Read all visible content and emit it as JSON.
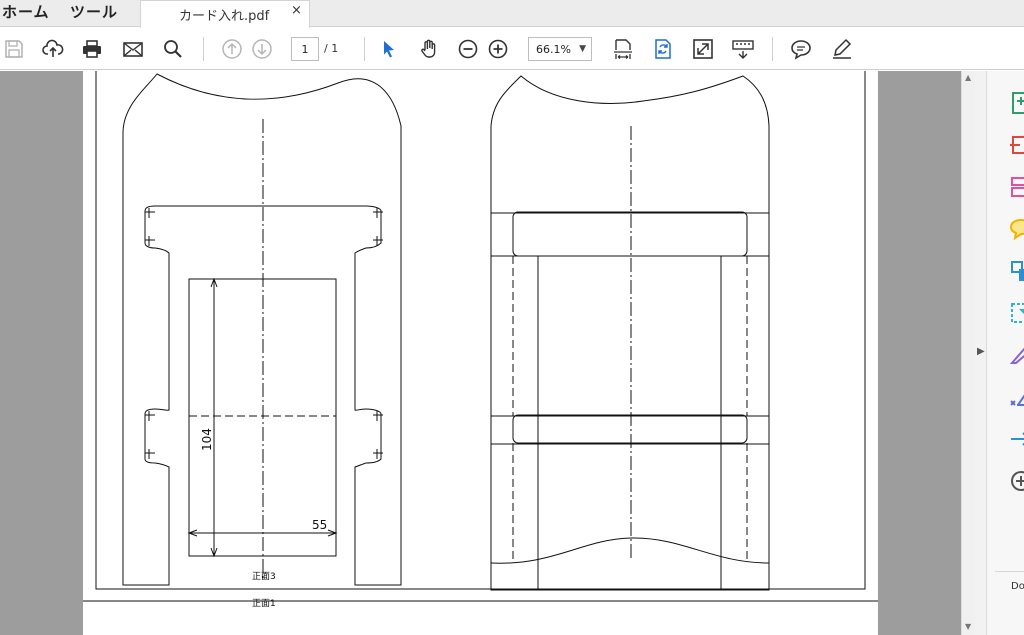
{
  "menu": {
    "home_label": "ホーム",
    "tools_label": "ツール"
  },
  "tab": {
    "title": "カード入れ.pdf",
    "close_label": "×"
  },
  "toolbar": {
    "icons": [
      "save-icon",
      "upload-icon",
      "print-icon",
      "email-icon",
      "search-icon",
      "page-up-icon",
      "page-down-icon",
      "select-arrow-icon",
      "hand-icon",
      "zoom-out-icon",
      "zoom-in-icon",
      "fit-page-icon",
      "rotate-icon",
      "full-screen-icon",
      "read-mode-icon",
      "comment-icon",
      "sign-icon"
    ],
    "page_current": "1",
    "page_total": "/ 1",
    "zoom_value": "66.1%",
    "zoom_caret": "▼"
  },
  "drawing": {
    "dimension_vertical": "104",
    "dimension_horizontal": "55",
    "label_front3": "正面3",
    "label_front1": "正面1"
  },
  "scrollbar": {
    "up": "▲",
    "down": "▼"
  },
  "right_panel": {
    "collapse_arrow": "▶",
    "tools": [
      "export-pdf-icon",
      "create-pdf-icon",
      "organize-pages-icon",
      "comment-tool-icon",
      "combine-files-icon",
      "compress-pdf-icon",
      "fill-sign-icon",
      "redact-icon",
      "send-icon",
      "more-tools-icon"
    ],
    "colors": [
      "#2e9e6b",
      "#e0463a",
      "#e64f9c",
      "#f0b400",
      "#2c8fd6",
      "#2db6c8",
      "#8a63d2",
      "#5b6fd6",
      "#2c8fd6",
      "#555555"
    ],
    "bottom_label": "Do"
  }
}
